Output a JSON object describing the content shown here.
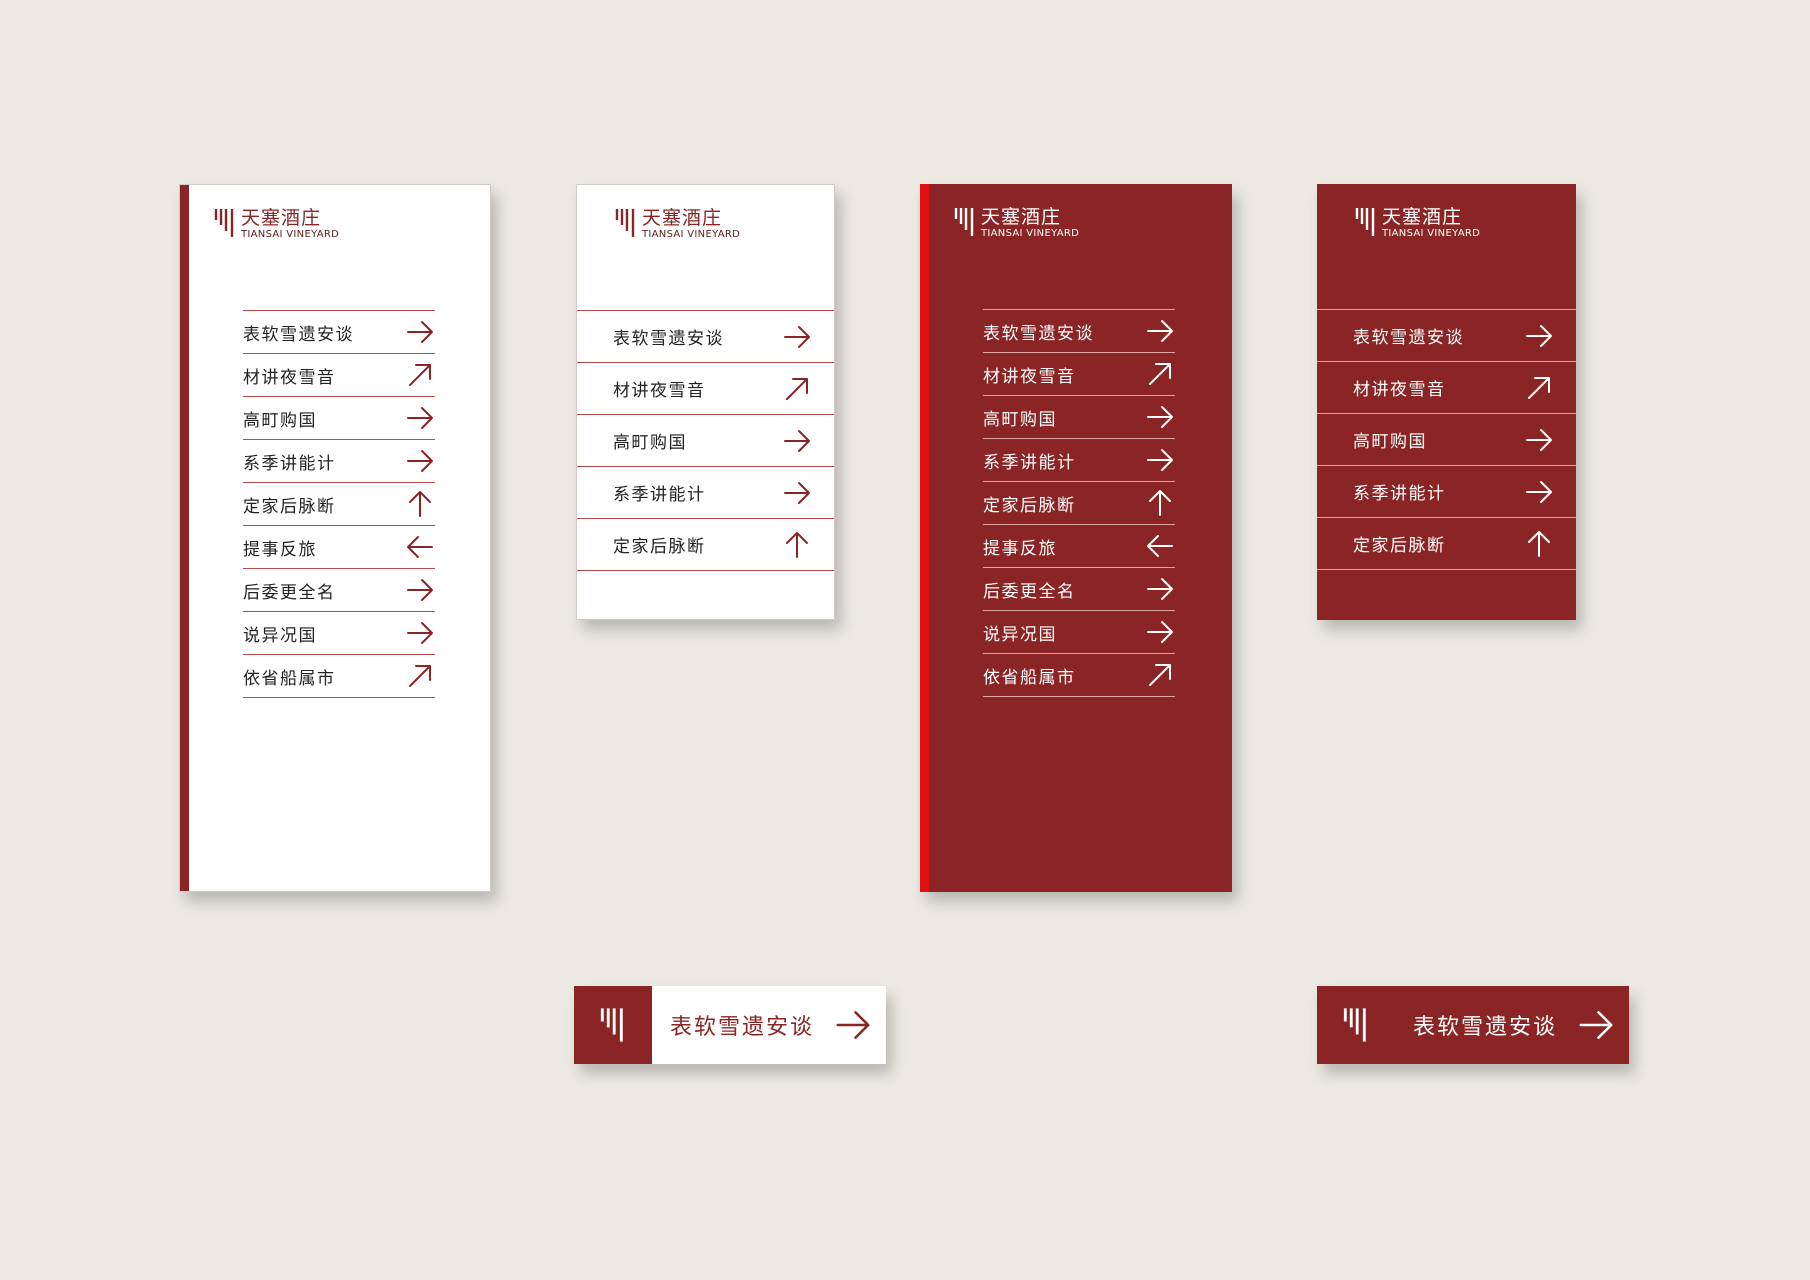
{
  "brand": {
    "name_cn": "天塞酒庄",
    "name_en": "TIANSAI VINEYARD"
  },
  "colors": {
    "brand_red": "#8B2525",
    "accent_red": "#E01010",
    "background": "#EDEAE4",
    "white": "#FFFFFF"
  },
  "tall_directory": [
    {
      "label": "表软雪遗安谈",
      "arrow": "arrow-right-icon"
    },
    {
      "label": "材讲夜雪音",
      "arrow": "arrow-up-right-icon"
    },
    {
      "label": "高町购国",
      "arrow": "arrow-right-icon"
    },
    {
      "label": "系季讲能计",
      "arrow": "arrow-right-icon"
    },
    {
      "label": "定家后脉断",
      "arrow": "arrow-up-icon"
    },
    {
      "label": "提事反旅",
      "arrow": "arrow-left-icon"
    },
    {
      "label": "后委更全名",
      "arrow": "arrow-right-icon"
    },
    {
      "label": "说异况国",
      "arrow": "arrow-right-icon"
    },
    {
      "label": "依省船属市",
      "arrow": "arrow-up-right-icon"
    }
  ],
  "short_directory": [
    {
      "label": "表软雪遗安谈",
      "arrow": "arrow-right-icon"
    },
    {
      "label": "材讲夜雪音",
      "arrow": "arrow-up-right-icon"
    },
    {
      "label": "高町购国",
      "arrow": "arrow-right-icon"
    },
    {
      "label": "系季讲能计",
      "arrow": "arrow-right-icon"
    },
    {
      "label": "定家后脉断",
      "arrow": "arrow-up-icon"
    }
  ],
  "banner": {
    "label": "表软雪遗安谈",
    "arrow": "arrow-right-icon"
  }
}
